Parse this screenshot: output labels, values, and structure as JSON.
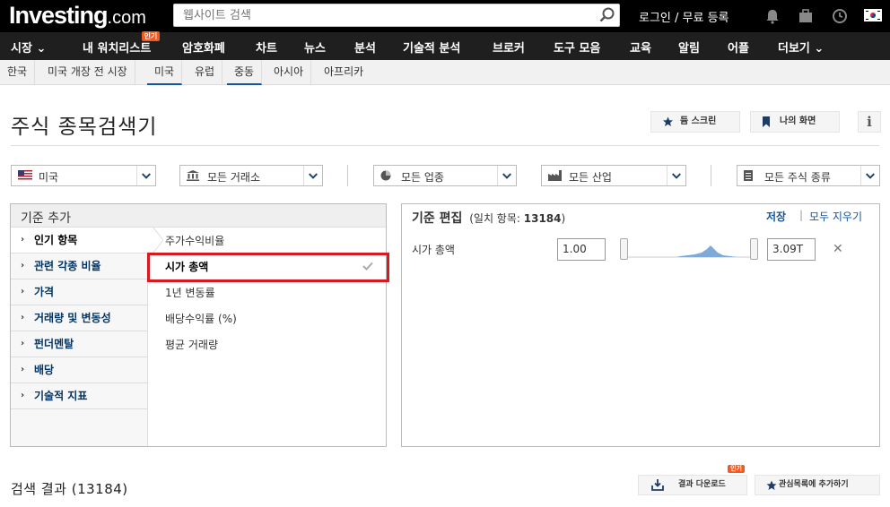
{
  "header": {
    "logo_main": "Investing",
    "logo_suffix": ".com",
    "search_placeholder": "웹사이트 검색",
    "login": "로그인 / 무료 등록"
  },
  "nav": [
    {
      "label": "시장 ⌄"
    },
    {
      "label": "내 워치리스트",
      "badge": "인기"
    },
    {
      "label": "암호화폐"
    },
    {
      "label": "차트"
    },
    {
      "label": "뉴스"
    },
    {
      "label": "분석"
    },
    {
      "label": "기술적 분석"
    },
    {
      "label": "브로커"
    },
    {
      "label": "도구 모음"
    },
    {
      "label": "교육"
    },
    {
      "label": "알림"
    },
    {
      "label": "어플"
    },
    {
      "label": "더보기 ⌄"
    }
  ],
  "subnav": [
    "한국",
    "미국 개장 전 시장",
    "미국",
    "유럽",
    "중동",
    "아시아",
    "아프리카"
  ],
  "page_title": "주식 종목검색기",
  "buttons": {
    "my_screener": "듐 스크린",
    "my_screen": "나의 화면",
    "info": "i"
  },
  "filters": [
    "미국",
    "모든 거래소",
    "모든 업종",
    "모든 산업",
    "모든 주식 종류"
  ],
  "criteria": {
    "title": "기준 추가",
    "categories": [
      "인기 항목",
      "관련 각종 비율",
      "가격",
      "거래량 및 변동성",
      "펀더멘탈",
      "배당",
      "기술적 지표"
    ],
    "items": [
      "주가수익비율",
      "시가 총액",
      "1년 변동률",
      "배당수익률 (%)",
      "평균 거래량"
    ]
  },
  "edit": {
    "title": "기준 편집",
    "match_prefix": "(일치 항목: ",
    "match_count": "13184",
    "match_suffix": ")",
    "save": "저장",
    "sep": "|",
    "clear": "모두 지우기",
    "row_label": "시가 총액",
    "min": "1.00",
    "max": "3.09T",
    "remove": "✕"
  },
  "results": {
    "label": "검색 결과 (13184)",
    "download": "결과 다운로드",
    "download_badge": "인기",
    "watchlist": "관심목록에 추가하기"
  }
}
